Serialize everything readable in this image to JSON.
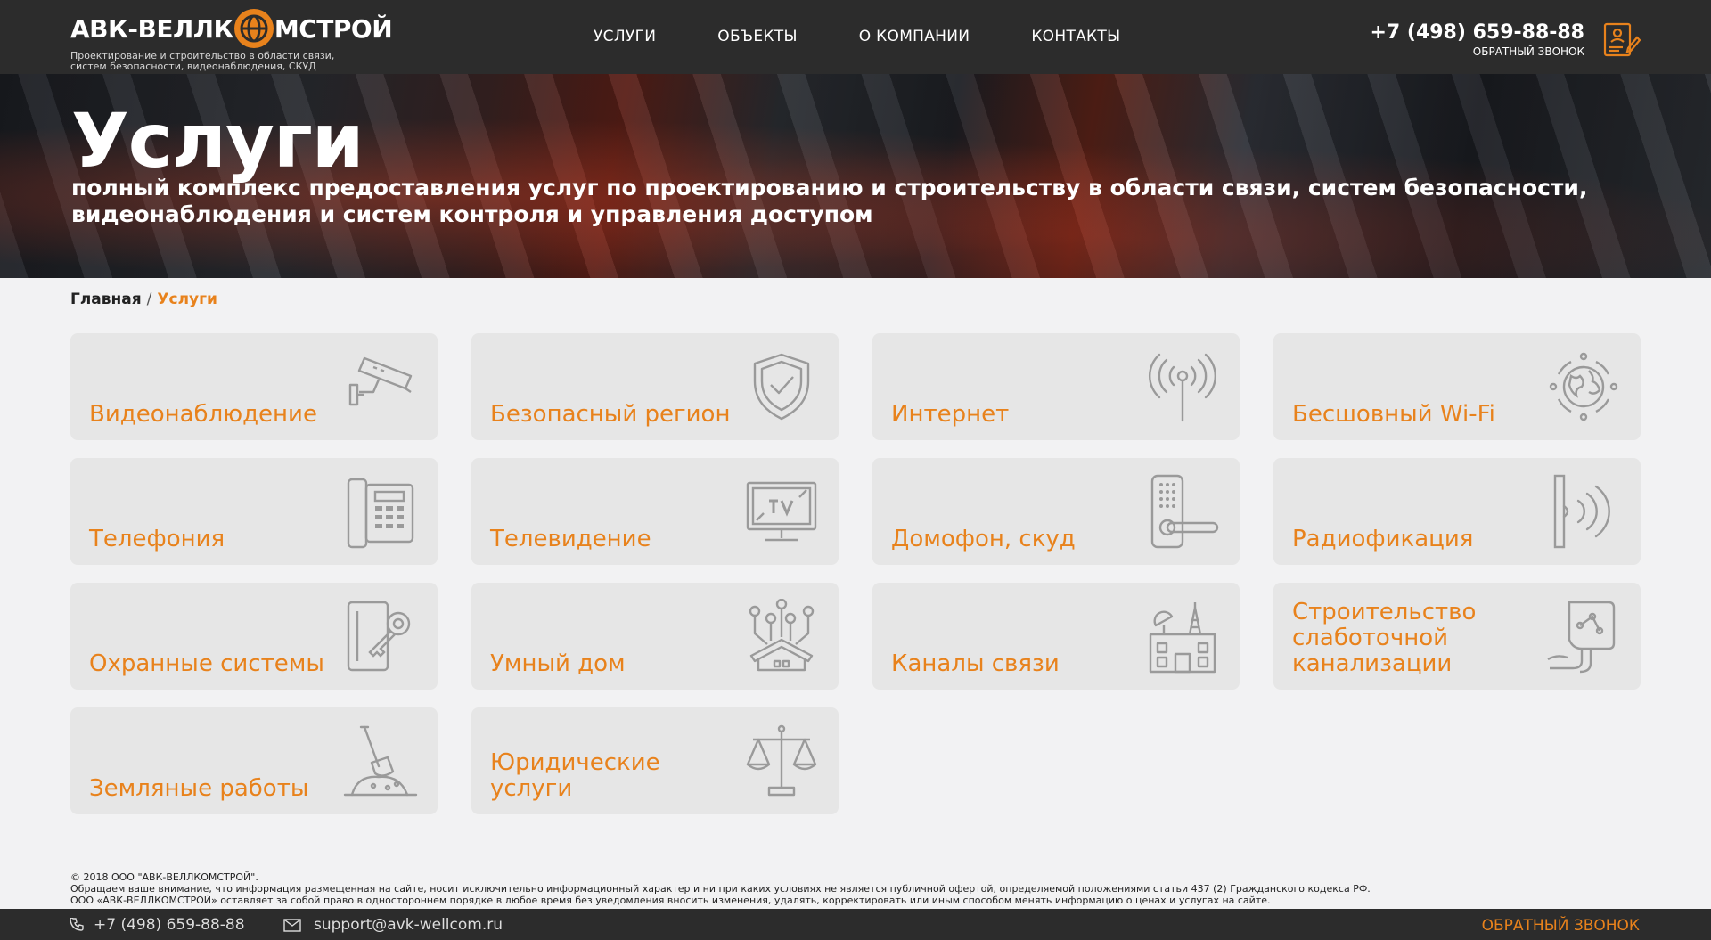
{
  "header": {
    "logo_text_left": "АВК-ВЕЛЛК",
    "logo_text_right": "МСТРОЙ",
    "tagline": "Проектирование и строительство в области связи, систем безопасности, видеонаблюдения, СКУД",
    "nav": [
      {
        "label": "УСЛУГИ"
      },
      {
        "label": "ОБЪЕКТЫ"
      },
      {
        "label": "О КОМПАНИИ"
      },
      {
        "label": "КОНТАКТЫ"
      }
    ],
    "phone": "+7 (498) 659-88-88",
    "callback": "ОБРАТНЫЙ ЗВОНОК"
  },
  "banner": {
    "title": "Услуги",
    "subtitle": "полный комплекс предоставления услуг по проектированию и строительству в области связи, систем безопасности, видеонаблюдения и систем контроля и управления доступом"
  },
  "breadcrumb": {
    "home": "Главная",
    "separator": "/",
    "current": "Услуги"
  },
  "services": [
    {
      "label": "Видеонаблюдение",
      "icon": "cctv-camera-icon"
    },
    {
      "label": "Безопасный регион",
      "icon": "shield-check-icon"
    },
    {
      "label": "Интернет",
      "icon": "antenna-icon"
    },
    {
      "label": "Бесшовный Wi-Fi",
      "icon": "globe-network-icon"
    },
    {
      "label": "Телефония",
      "icon": "desk-phone-icon"
    },
    {
      "label": "Телевидение",
      "icon": "tv-icon"
    },
    {
      "label": "Домофон, скуд",
      "icon": "door-lock-keypad-icon"
    },
    {
      "label": "Радиофикация",
      "icon": "radio-waves-icon"
    },
    {
      "label": "Охранные системы",
      "icon": "key-lock-icon"
    },
    {
      "label": "Умный дом",
      "icon": "smart-home-icon"
    },
    {
      "label": "Каналы связи",
      "icon": "comm-tower-icon"
    },
    {
      "label": "Строительство слаботочной канализации",
      "icon": "cable-duct-icon"
    },
    {
      "label": "Земляные работы",
      "icon": "shovel-icon"
    },
    {
      "label": "Юридические услуги",
      "icon": "scales-icon"
    }
  ],
  "footer": {
    "copyright": "© 2018 ООО \"АВК-ВЕЛЛКОМСТРОЙ\".",
    "notice1": "Обращаем ваше внимание, что информация размещенная на сайте, носит исключительно информационный характер и ни при каких условиях не является публичной офертой, определяемой положениями статьи 437 (2) Гражданского кодекса РФ.",
    "notice2": "ООО «АВК-ВЕЛЛКОМСТРОЙ» оставляет за собой право в одностороннем порядке в любое время без уведомления вносить изменения, удалять, корректировать или иным способом менять информацию о ценах и услугах на сайте.",
    "phone": "+7 (498) 659-88-88",
    "email": "support@avk-wellcom.ru",
    "callback": "ОБРАТНЫЙ ЗВОНОК"
  },
  "colors": {
    "accent": "#e8821c",
    "header_bg": "#2c2c2c",
    "card_bg": "#e6e6e6",
    "icon_gray": "#9a9a9a"
  }
}
